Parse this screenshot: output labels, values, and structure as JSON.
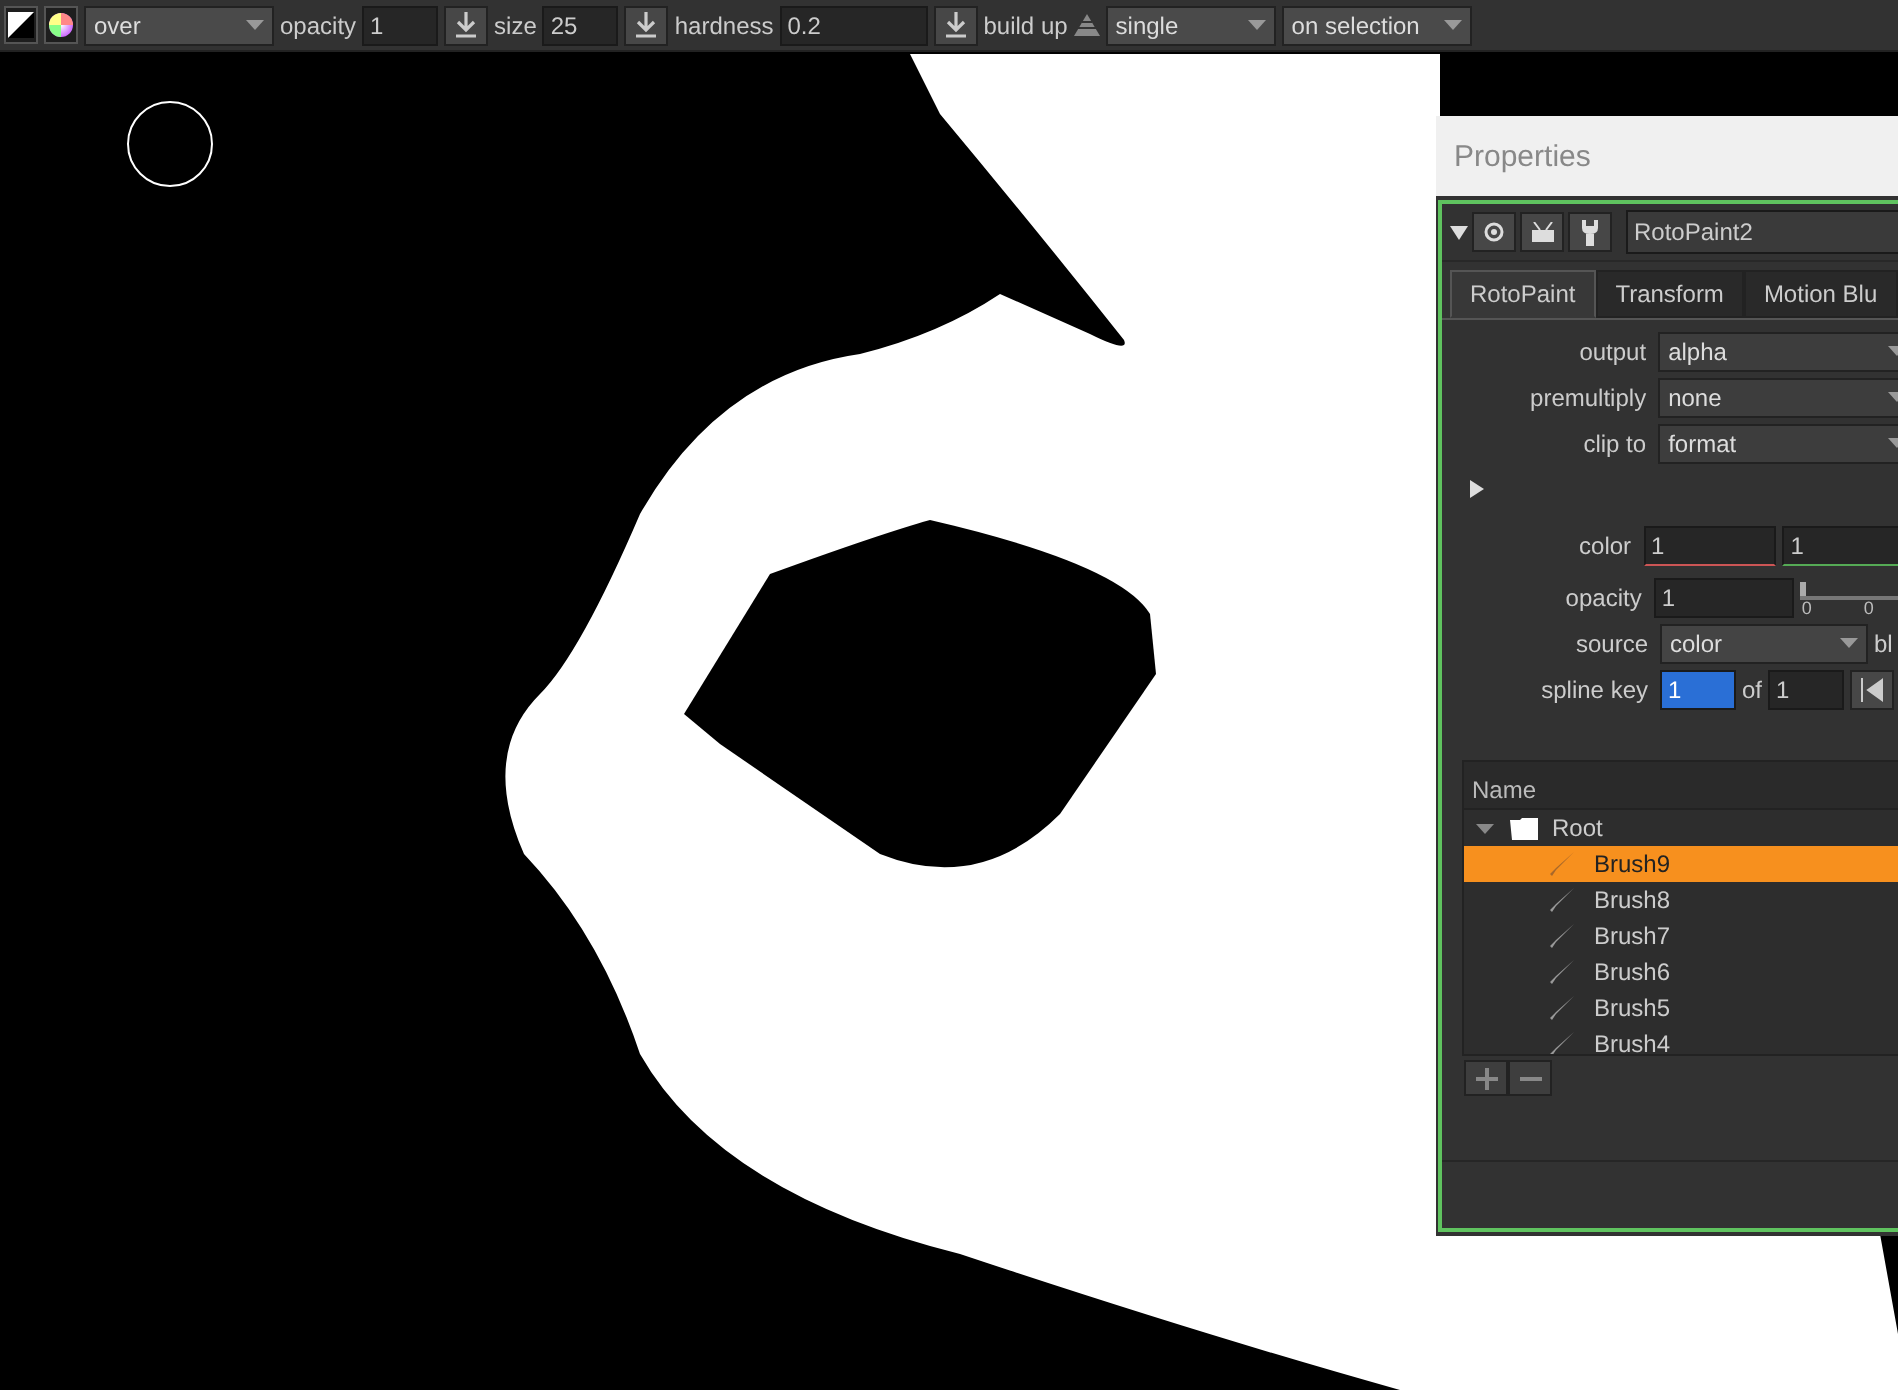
{
  "toolbar": {
    "blend_mode": "over",
    "opacity_label": "opacity",
    "opacity": "1",
    "size_label": "size",
    "size": "25",
    "hardness_label": "hardness",
    "hardness": "0.2",
    "build_up_label": "build up",
    "stroke_mode": "single",
    "lifetime": "on selection"
  },
  "properties": {
    "title": "Properties",
    "node_name": "RotoPaint2",
    "tabs": [
      {
        "label": "RotoPaint",
        "selected": true
      },
      {
        "label": "Transform",
        "selected": false
      },
      {
        "label": "Motion Blu",
        "selected": false
      }
    ],
    "dropdowns": [
      {
        "label": "output",
        "value": "alpha"
      },
      {
        "label": "premultiply",
        "value": "none"
      },
      {
        "label": "clip to",
        "value": "format"
      }
    ],
    "color": {
      "label": "color",
      "values": [
        "1",
        "1"
      ]
    },
    "opacity": {
      "label": "opacity",
      "value": "1",
      "ticks": [
        "0",
        "0"
      ],
      "level": 0
    },
    "source": {
      "label": "source",
      "value": "color",
      "extra": "bl"
    },
    "spline_key": {
      "label": "spline key",
      "value": "1",
      "of_label": "of",
      "of_value": "1"
    },
    "tree": {
      "column": "Name",
      "root": {
        "label": "Root",
        "expanded": true,
        "children": [
          {
            "label": "Brush9",
            "selected": true
          },
          {
            "label": "Brush8",
            "selected": false
          },
          {
            "label": "Brush7",
            "selected": false
          },
          {
            "label": "Brush6",
            "selected": false
          },
          {
            "label": "Brush5",
            "selected": false
          },
          {
            "label": "Brush4",
            "selected": false
          }
        ]
      }
    }
  }
}
